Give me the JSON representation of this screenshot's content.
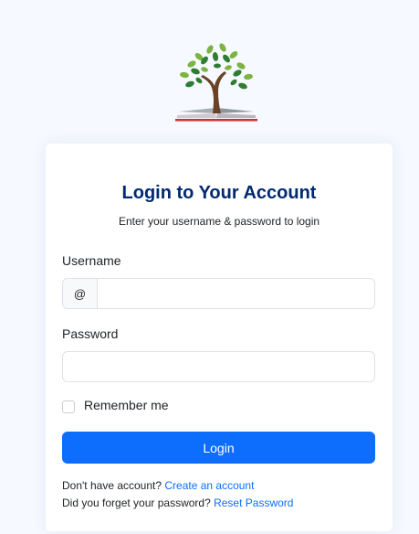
{
  "logo": {
    "icon": "tree-book-logo-icon"
  },
  "card": {
    "title": "Login to Your Account",
    "subtitle": "Enter your username & password to login",
    "username": {
      "label": "Username",
      "prefix": "@",
      "value": ""
    },
    "password": {
      "label": "Password",
      "value": ""
    },
    "remember": {
      "label": "Remember me",
      "checked": false
    },
    "login_button": "Login",
    "signup": {
      "text": "Don't have account? ",
      "link": "Create an account"
    },
    "reset": {
      "text": "Did you forget your password? ",
      "link": "Reset Password"
    }
  },
  "colors": {
    "background": "#f6f9ff",
    "title": "#012970",
    "primary": "#0d6efd"
  }
}
